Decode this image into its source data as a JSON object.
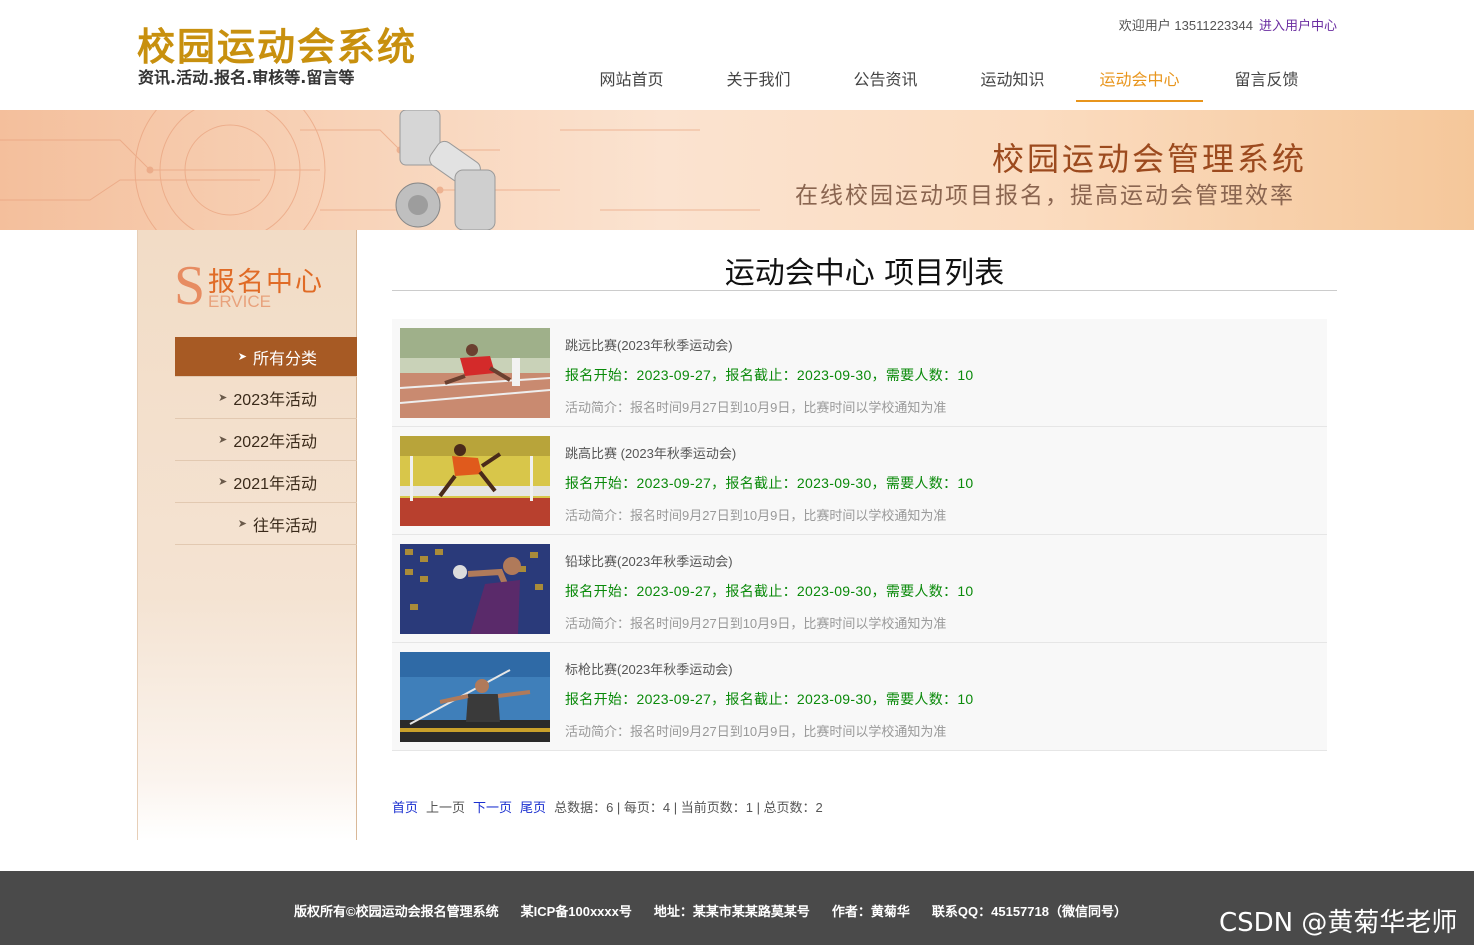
{
  "header": {
    "logo_title": "校园运动会系统",
    "logo_subtitle": "资讯.活动.报名.审核等.留言等",
    "welcome_text": "欢迎用户 13511223344",
    "user_center_link": "进入用户中心"
  },
  "nav": {
    "items": [
      {
        "label": "网站首页"
      },
      {
        "label": "关于我们"
      },
      {
        "label": "公告资讯"
      },
      {
        "label": "运动知识"
      },
      {
        "label": "运动会中心"
      },
      {
        "label": "留言反馈"
      }
    ],
    "active_index": 4
  },
  "banner": {
    "title": "校园运动会管理系统",
    "subtitle": "在线校园运动项目报名，提高运动会管理效率"
  },
  "sidebar": {
    "head_letter": "S",
    "head_cn": "报名中心",
    "head_en": "ERVICE",
    "items": [
      {
        "label": "所有分类",
        "active": true
      },
      {
        "label": "2023年活动",
        "active": false
      },
      {
        "label": "2022年活动",
        "active": false
      },
      {
        "label": "2021年活动",
        "active": false
      },
      {
        "label": "往年活动",
        "active": false
      }
    ]
  },
  "main": {
    "title": "运动会中心 项目列表",
    "rows": [
      {
        "title": "跳远比赛(2023年秋季运动会)",
        "meta": "报名开始：2023-09-27，报名截止：2023-09-30，需要人数：10",
        "desc": "活动简介：报名时间9月27日到10月9日，比赛时间以学校通知为准",
        "image_alt": "long-jump-photo"
      },
      {
        "title": "跳高比赛 (2023年秋季运动会)",
        "meta": "报名开始：2023-09-27，报名截止：2023-09-30，需要人数：10",
        "desc": "活动简介：报名时间9月27日到10月9日，比赛时间以学校通知为准",
        "image_alt": "high-jump-photo"
      },
      {
        "title": "铅球比赛(2023年秋季运动会)",
        "meta": "报名开始：2023-09-27，报名截止：2023-09-30，需要人数：10",
        "desc": "活动简介：报名时间9月27日到10月9日，比赛时间以学校通知为准",
        "image_alt": "shot-put-photo"
      },
      {
        "title": "标枪比赛(2023年秋季运动会)",
        "meta": "报名开始：2023-09-27，报名截止：2023-09-30，需要人数：10",
        "desc": "活动简介：报名时间9月27日到10月9日，比赛时间以学校通知为准",
        "image_alt": "javelin-photo"
      }
    ]
  },
  "pager": {
    "first": "首页",
    "prev": "上一页",
    "next": "下一页",
    "last": "尾页",
    "summary": "总数据：6 | 每页：4 | 当前页数：1 | 总页数：2"
  },
  "footer": {
    "copyright": "版权所有©校园运动会报名管理系统",
    "icp": "某ICP备100xxxx号",
    "address": "地址：某某市某某路莫某号",
    "author": "作者：黄菊华",
    "qq": "联系QQ：45157718（微信同号）"
  },
  "watermark": "CSDN @黄菊华老师",
  "colors": {
    "accent": "#e8951c",
    "logo": "#c8900e",
    "sidebar_active": "#a75a24",
    "meta_green": "#0a8a0a",
    "footer_bg": "#4a4a4a"
  }
}
